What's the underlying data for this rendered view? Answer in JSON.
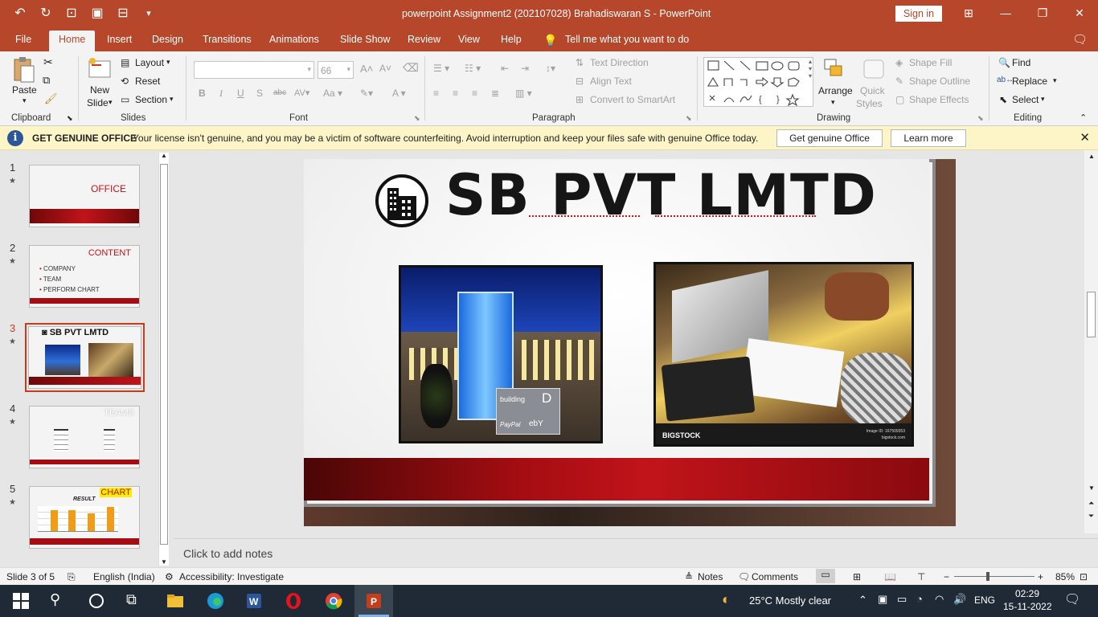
{
  "window": {
    "title": "powerpoint Assignment2 (202107028) Brahadiswaran S  -  PowerPoint",
    "sign_in": "Sign in"
  },
  "menu": [
    "File",
    "Home",
    "Insert",
    "Design",
    "Transitions",
    "Animations",
    "Slide Show",
    "Review",
    "View",
    "Help"
  ],
  "tell_me": "Tell me what you want to do",
  "ribbon": {
    "clipboard": {
      "label": "Clipboard",
      "paste": "Paste"
    },
    "slides": {
      "label": "Slides",
      "new_slide_1": "New",
      "new_slide_2": "Slide",
      "layout": "Layout",
      "reset": "Reset",
      "section": "Section"
    },
    "font": {
      "label": "Font",
      "size": "66"
    },
    "paragraph": {
      "label": "Paragraph",
      "text_direction": "Text Direction",
      "align_text": "Align Text",
      "convert_smartart": "Convert to SmartArt"
    },
    "drawing": {
      "label": "Drawing",
      "arrange": "Arrange",
      "quick_styles_1": "Quick",
      "quick_styles_2": "Styles",
      "shape_fill": "Shape Fill",
      "shape_outline": "Shape Outline",
      "shape_effects": "Shape Effects"
    },
    "editing": {
      "label": "Editing",
      "find": "Find",
      "replace": "Replace",
      "select": "Select"
    }
  },
  "notification": {
    "title": "GET GENUINE OFFICE",
    "message": "Your license isn't genuine, and you may be a victim of software counterfeiting. Avoid interruption and keep your files safe with genuine Office today.",
    "btn_genuine": "Get genuine Office",
    "btn_learn": "Learn more"
  },
  "thumbnails": {
    "t1": {
      "num": "1",
      "title": "OFFICE"
    },
    "t2": {
      "num": "2",
      "title": "CONTENT",
      "items": [
        "COMPANY",
        "TEAM",
        "PERFORM CHART"
      ]
    },
    "t3": {
      "num": "3",
      "title": "SB PVT LMTD"
    },
    "t4": {
      "num": "4",
      "title": "TEAMS"
    },
    "t5": {
      "num": "5",
      "title": "CHART",
      "result": "RESULT"
    }
  },
  "slide": {
    "title": "SB PVT LMTD",
    "photo_caption": "BIGSTOCK",
    "photo_id": "Image ID: 167509353",
    "photo_site": "bigstock.com",
    "sign_building": "building",
    "sign_letter": "D",
    "sign_paypal": "PayPal",
    "sign_ebay": "ebY"
  },
  "notes_placeholder": "Click to add notes",
  "status": {
    "slide_of": "Slide 3 of 5",
    "language": "English (India)",
    "accessibility": "Accessibility: Investigate",
    "notes": "Notes",
    "comments": "Comments",
    "zoom": "85%"
  },
  "taskbar": {
    "weather": "25°C  Mostly clear",
    "lang": "ENG",
    "time": "02:29",
    "date": "15-11-2022"
  },
  "colors": {
    "accent": "#b7472a",
    "slide_band": "#9b0b0b"
  }
}
